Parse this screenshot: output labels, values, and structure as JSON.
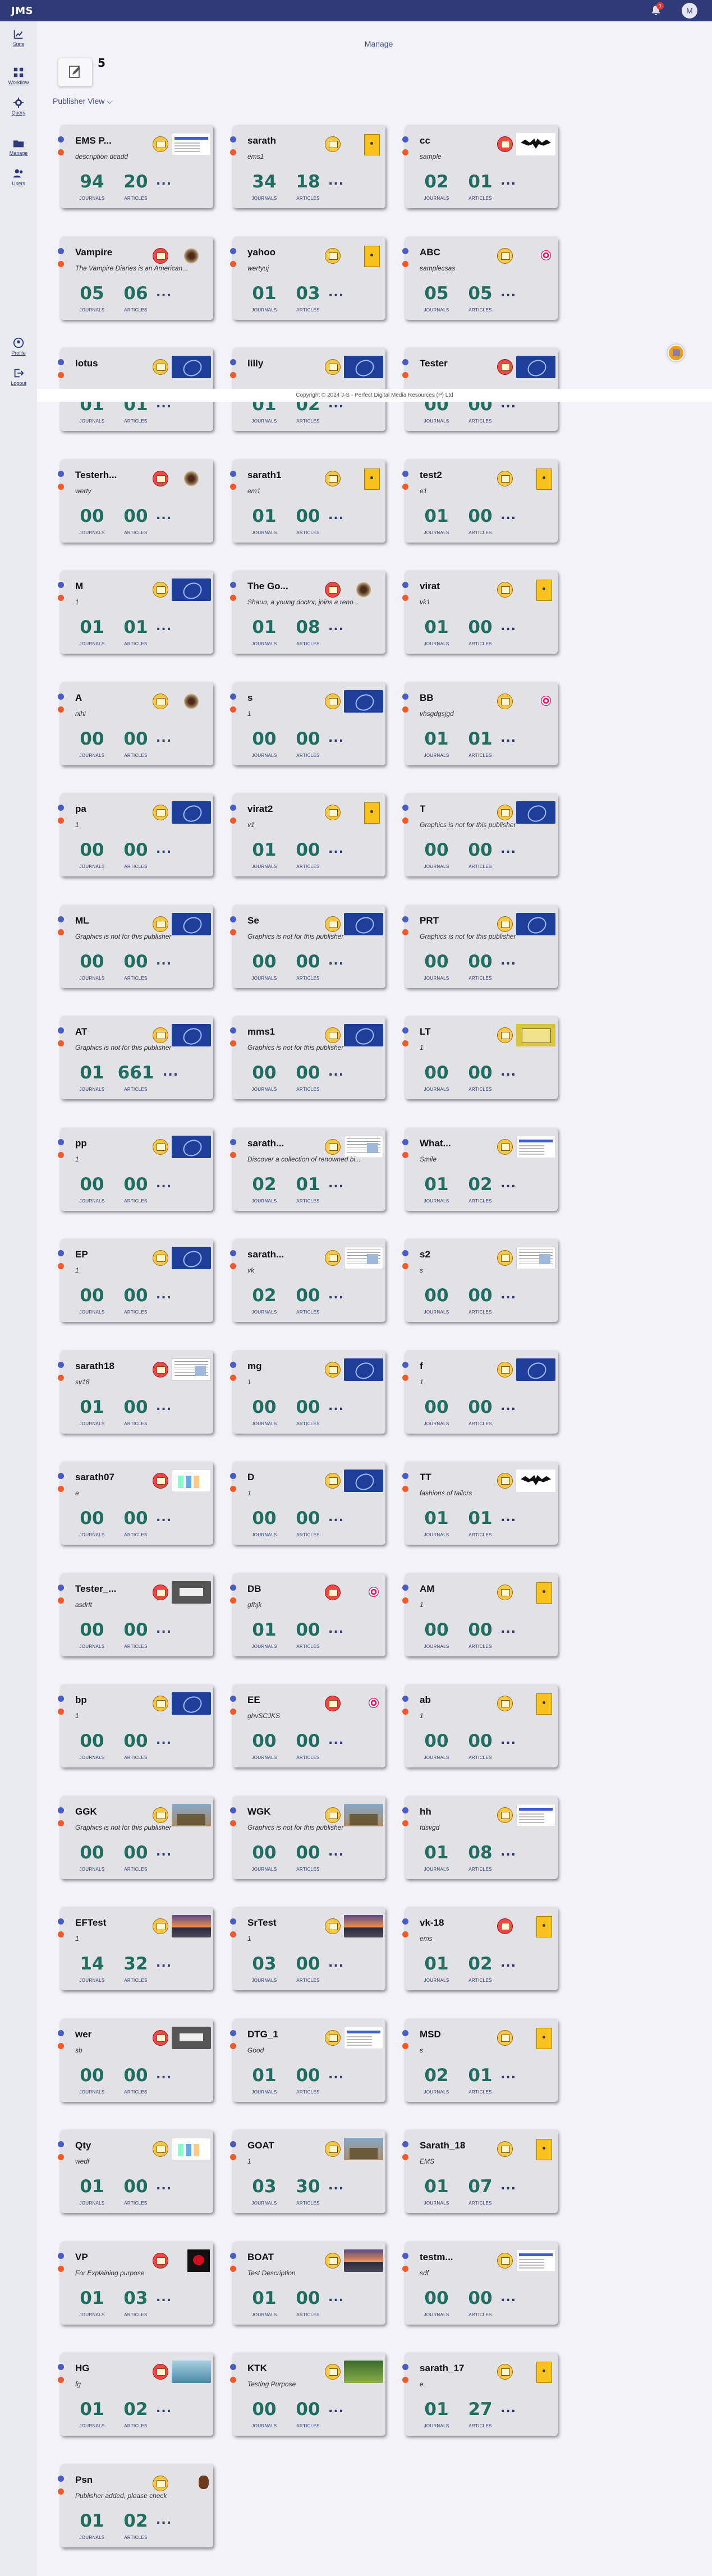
{
  "app": {
    "brand": "JMS",
    "notification_count": "1",
    "user_initial": "M"
  },
  "sidebar": {
    "items": [
      {
        "label": "Stats",
        "icon": "stats-icon"
      },
      {
        "label": "Workflow",
        "icon": "workflow-icon"
      },
      {
        "label": "Query",
        "icon": "query-icon"
      },
      {
        "label": "Manage",
        "icon": "manage-icon"
      },
      {
        "label": "Users",
        "icon": "users-icon"
      },
      {
        "label": "Profile",
        "icon": "profile-icon"
      },
      {
        "label": "Logout",
        "icon": "logout-icon"
      }
    ]
  },
  "page": {
    "title": "Manage",
    "publisher_count": "5",
    "view_selector": "Publisher View",
    "footer": "Copyright © 2024 J-S - Perfect Digital Media Resources (P) Ltd"
  },
  "colors": {
    "header": "#2e3b78",
    "count": "#1f6e5f",
    "dot_blue": "#4a5bc4",
    "dot_orange": "#f05a2a"
  },
  "card_labels": {
    "journals": "JOURNALS",
    "articles": "ARTICLES",
    "more": "..."
  },
  "publishers": [
    {
      "name": "EMS P...",
      "description": "description dcadd",
      "journals": "94",
      "articles": "20",
      "badge": "yellow",
      "thumb": "scan"
    },
    {
      "name": "sarath",
      "description": "ems1",
      "journals": "34",
      "articles": "18",
      "badge": "yellow",
      "thumb": "yellow"
    },
    {
      "name": "cc",
      "description": "sample",
      "journals": "02",
      "articles": "01",
      "badge": "red",
      "thumb": "bat"
    },
    {
      "name": "Vampire",
      "description": "The Vampire Diaries is an American...",
      "journals": "05",
      "articles": "06",
      "badge": "red",
      "thumb": "fly"
    },
    {
      "name": "yahoo",
      "description": "wertyuj",
      "journals": "01",
      "articles": "03",
      "badge": "yellow",
      "thumb": "yellow"
    },
    {
      "name": "ABC",
      "description": "samplecsas",
      "journals": "05",
      "articles": "05",
      "badge": "yellow",
      "thumb": "target"
    },
    {
      "name": "lotus",
      "description": "",
      "journals": "01",
      "articles": "01",
      "badge": "yellow",
      "thumb": "blue"
    },
    {
      "name": "lilly",
      "description": "",
      "journals": "01",
      "articles": "02",
      "badge": "yellow",
      "thumb": "blue"
    },
    {
      "name": "Tester",
      "description": "",
      "journals": "00",
      "articles": "00",
      "badge": "red",
      "thumb": "blue"
    },
    {
      "name": "Testerh...",
      "description": "werty",
      "journals": "00",
      "articles": "00",
      "badge": "red",
      "thumb": "fly"
    },
    {
      "name": "sarath1",
      "description": "em1",
      "journals": "01",
      "articles": "00",
      "badge": "yellow",
      "thumb": "yellow"
    },
    {
      "name": "test2",
      "description": "e1",
      "journals": "01",
      "articles": "00",
      "badge": "yellow",
      "thumb": "yellow"
    },
    {
      "name": "M",
      "description": "1",
      "journals": "01",
      "articles": "01",
      "badge": "yellow",
      "thumb": "blue"
    },
    {
      "name": "The Go...",
      "description": "Shaun, a young doctor, joins a reno...",
      "journals": "01",
      "articles": "08",
      "badge": "red",
      "thumb": "fly"
    },
    {
      "name": "virat",
      "description": "vk1",
      "journals": "01",
      "articles": "00",
      "badge": "yellow",
      "thumb": "yellow"
    },
    {
      "name": "A",
      "description": "nihi",
      "journals": "00",
      "articles": "00",
      "badge": "yellow",
      "thumb": "fly"
    },
    {
      "name": "s",
      "description": "1",
      "journals": "00",
      "articles": "00",
      "badge": "yellow",
      "thumb": "blue"
    },
    {
      "name": "BB",
      "description": "vhsgdgsjgd",
      "journals": "01",
      "articles": "01",
      "badge": "yellow",
      "thumb": "target"
    },
    {
      "name": "pa",
      "description": "1",
      "journals": "00",
      "articles": "00",
      "badge": "yellow",
      "thumb": "blue"
    },
    {
      "name": "virat2",
      "description": "v1",
      "journals": "01",
      "articles": "00",
      "badge": "yellow",
      "thumb": "yellow"
    },
    {
      "name": "T",
      "description": "Graphics is not for this publisher",
      "journals": "00",
      "articles": "00",
      "badge": "yellow",
      "thumb": "blue"
    },
    {
      "name": "ML",
      "description": "Graphics is not for this publisher",
      "journals": "00",
      "articles": "00",
      "badge": "yellow",
      "thumb": "blue"
    },
    {
      "name": "Se",
      "description": "Graphics is not for this publisher",
      "journals": "00",
      "articles": "00",
      "badge": "yellow",
      "thumb": "blue"
    },
    {
      "name": "PRT",
      "description": "Graphics is not for this publisher",
      "journals": "00",
      "articles": "00",
      "badge": "yellow",
      "thumb": "blue"
    },
    {
      "name": "AT",
      "description": "Graphics is not for this publisher",
      "journals": "01",
      "articles": "661",
      "badge": "yellow",
      "thumb": "blue"
    },
    {
      "name": "mms1",
      "description": "Graphics is not for this publisher",
      "journals": "00",
      "articles": "00",
      "badge": "yellow",
      "thumb": "blue"
    },
    {
      "name": "LT",
      "description": "1",
      "journals": "00",
      "articles": "00",
      "badge": "yellow",
      "thumb": "gold"
    },
    {
      "name": "pp",
      "description": "1",
      "journals": "00",
      "articles": "00",
      "badge": "yellow",
      "thumb": "blue"
    },
    {
      "name": "sarath...",
      "description": "Discover a collection of renowned bi...",
      "journals": "02",
      "articles": "01",
      "badge": "yellow",
      "thumb": "doc"
    },
    {
      "name": "What...",
      "description": "Smile",
      "journals": "01",
      "articles": "02",
      "badge": "yellow",
      "thumb": "scan"
    },
    {
      "name": "EP",
      "description": "1",
      "journals": "00",
      "articles": "00",
      "badge": "yellow",
      "thumb": "blue"
    },
    {
      "name": "sarath...",
      "description": "vk",
      "journals": "02",
      "articles": "00",
      "badge": "yellow",
      "thumb": "doc"
    },
    {
      "name": "s2",
      "description": "s",
      "journals": "00",
      "articles": "00",
      "badge": "yellow",
      "thumb": "doc"
    },
    {
      "name": "sarath18",
      "description": "sv18",
      "journals": "01",
      "articles": "00",
      "badge": "red",
      "thumb": "doc"
    },
    {
      "name": "mg",
      "description": "1",
      "journals": "00",
      "articles": "00",
      "badge": "yellow",
      "thumb": "blue"
    },
    {
      "name": "f",
      "description": "1",
      "journals": "00",
      "articles": "00",
      "badge": "yellow",
      "thumb": "blue"
    },
    {
      "name": "sarath07",
      "description": "e",
      "journals": "00",
      "articles": "00",
      "badge": "red",
      "thumb": "chart"
    },
    {
      "name": "D",
      "description": "1",
      "journals": "00",
      "articles": "00",
      "badge": "yellow",
      "thumb": "blue"
    },
    {
      "name": "TT",
      "description": "fashions of tailors",
      "journals": "01",
      "articles": "01",
      "badge": "yellow",
      "thumb": "bat"
    },
    {
      "name": "Tester_...",
      "description": "asdrft",
      "journals": "00",
      "articles": "00",
      "badge": "red",
      "thumb": "screen"
    },
    {
      "name": "DB",
      "description": "gfhjk",
      "journals": "01",
      "articles": "00",
      "badge": "red",
      "thumb": "target"
    },
    {
      "name": "AM",
      "description": "1",
      "journals": "00",
      "articles": "00",
      "badge": "yellow",
      "thumb": "yellow"
    },
    {
      "name": "bp",
      "description": "1",
      "journals": "00",
      "articles": "00",
      "badge": "yellow",
      "thumb": "blue"
    },
    {
      "name": "EE",
      "description": "ghvSCJKS",
      "journals": "00",
      "articles": "00",
      "badge": "red",
      "thumb": "target"
    },
    {
      "name": "ab",
      "description": "1",
      "journals": "00",
      "articles": "00",
      "badge": "yellow",
      "thumb": "yellow"
    },
    {
      "name": "GGK",
      "description": "Graphics is not for this publisher",
      "journals": "00",
      "articles": "00",
      "badge": "yellow",
      "thumb": "photo"
    },
    {
      "name": "WGK",
      "description": "Graphics is not for this publisher",
      "journals": "00",
      "articles": "00",
      "badge": "yellow",
      "thumb": "photo"
    },
    {
      "name": "hh",
      "description": "fdsvgd",
      "journals": "01",
      "articles": "08",
      "badge": "yellow",
      "thumb": "scan"
    },
    {
      "name": "EFTest",
      "description": "1",
      "journals": "14",
      "articles": "32",
      "badge": "yellow",
      "thumb": "sunset"
    },
    {
      "name": "SrTest",
      "description": "1",
      "journals": "03",
      "articles": "00",
      "badge": "yellow",
      "thumb": "sunset"
    },
    {
      "name": "vk-18",
      "description": "ems",
      "journals": "01",
      "articles": "02",
      "badge": "red",
      "thumb": "yellow"
    },
    {
      "name": "wer",
      "description": "sb",
      "journals": "00",
      "articles": "00",
      "badge": "red",
      "thumb": "screen"
    },
    {
      "name": "DTG_1",
      "description": "Good",
      "journals": "01",
      "articles": "00",
      "badge": "yellow",
      "thumb": "scan"
    },
    {
      "name": "MSD",
      "description": "s",
      "journals": "02",
      "articles": "01",
      "badge": "yellow",
      "thumb": "yellow"
    },
    {
      "name": "Qty",
      "description": "wedf",
      "journals": "01",
      "articles": "00",
      "badge": "yellow",
      "thumb": "chart"
    },
    {
      "name": "GOAT",
      "description": "1",
      "journals": "03",
      "articles": "30",
      "badge": "yellow",
      "thumb": "photo"
    },
    {
      "name": "Sarath_18",
      "description": "EMS",
      "journals": "01",
      "articles": "07",
      "badge": "yellow",
      "thumb": "yellow"
    },
    {
      "name": "VP",
      "description": "For Explaining purpose",
      "journals": "01",
      "articles": "03",
      "badge": "red",
      "thumb": "rose"
    },
    {
      "name": "BOAT",
      "description": "Test Description",
      "journals": "01",
      "articles": "00",
      "badge": "yellow",
      "thumb": "sunset"
    },
    {
      "name": "testm...",
      "description": "sdf",
      "journals": "00",
      "articles": "00",
      "badge": "yellow",
      "thumb": "scan"
    },
    {
      "name": "HG",
      "description": "fg",
      "journals": "01",
      "articles": "02",
      "badge": "red",
      "thumb": "sea"
    },
    {
      "name": "KTK",
      "description": "Testing Purpose",
      "journals": "00",
      "articles": "00",
      "badge": "yellow",
      "thumb": "green"
    },
    {
      "name": "sarath_17",
      "description": "e",
      "journals": "01",
      "articles": "27",
      "badge": "yellow",
      "thumb": "yellow"
    },
    {
      "name": "Psn",
      "description": "Publisher added, please check",
      "journals": "01",
      "articles": "02",
      "badge": "yellow",
      "thumb": "cartoon"
    }
  ]
}
